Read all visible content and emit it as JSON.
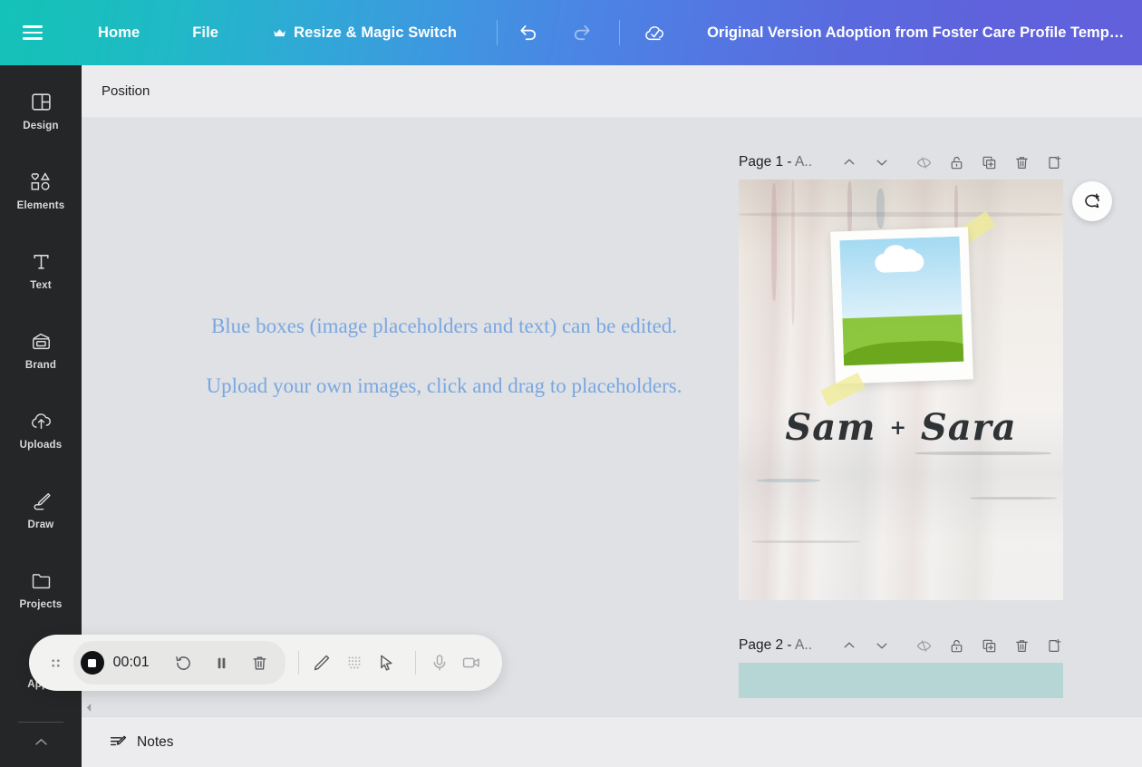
{
  "topbar": {
    "menu_icon": "hamburger-menu-icon",
    "home_label": "Home",
    "file_label": "File",
    "resize_label": "Resize & Magic Switch",
    "resize_badge_icon": "crown-icon",
    "undo_icon": "undo-arrow-icon",
    "redo_icon": "redo-arrow-icon",
    "saved_icon": "cloud-check-icon",
    "design_title": "Original Version Adoption from Foster Care Profile Temp…",
    "gradient_start": "#15c2b8",
    "gradient_end": "#6260db"
  },
  "sidebar": {
    "items": [
      {
        "label": "Design",
        "icon": "layout-design-icon"
      },
      {
        "label": "Elements",
        "icon": "shapes-elements-icon"
      },
      {
        "label": "Text",
        "icon": "text-t-icon"
      },
      {
        "label": "Brand",
        "icon": "brand-kit-icon"
      },
      {
        "label": "Uploads",
        "icon": "cloud-upload-icon"
      },
      {
        "label": "Draw",
        "icon": "pen-draw-icon"
      },
      {
        "label": "Projects",
        "icon": "folder-projects-icon"
      },
      {
        "label": "Apps",
        "icon": "apps-grid-icon"
      }
    ],
    "collapse_icon": "chevron-up-icon"
  },
  "toolbar": {
    "position_label": "Position"
  },
  "canvas": {
    "background_color": "#dfe1e5",
    "hint_line_1": "Blue boxes (image placeholders and text) can be edited.",
    "hint_line_2": "Upload your own images, click and drag to placeholders.",
    "hint_color": "#7aa7e0",
    "comment_button_icon": "add-comment-icon",
    "collapse_tab_icon": "chevron-up-icon",
    "scroll_left_icon": "scroll-left-arrow-icon"
  },
  "pages": [
    {
      "name_visible": "Page 1 - A..",
      "name_prefix": "Page 1 - ",
      "name_suffix": "A..",
      "controls": [
        {
          "icon": "chevron-up-icon",
          "name": "move-page-up"
        },
        {
          "icon": "chevron-down-icon",
          "name": "move-page-down"
        },
        {
          "icon": "eye-hidden-icon",
          "name": "hide-page"
        },
        {
          "icon": "unlock-icon",
          "name": "lock-page"
        },
        {
          "icon": "duplicate-page-icon",
          "name": "duplicate-page"
        },
        {
          "icon": "trash-icon",
          "name": "delete-page"
        },
        {
          "icon": "add-page-icon",
          "name": "add-page"
        }
      ],
      "artwork": {
        "title_text": "Sam + Sara",
        "name_left": "Sam",
        "separator": "+",
        "name_right": "Sara",
        "background": "textured-plaster-wall",
        "photo": "polaroid-landscape-photo",
        "photo_colors": {
          "sky": "#a3daf2",
          "cloud": "#ffffff",
          "hill_back": "#8dc63f",
          "hill_front": "#6ba81e"
        },
        "tape_color": "#f0ec96"
      }
    },
    {
      "name_visible": "Page 2 - A..",
      "name_prefix": "Page 2 - ",
      "name_suffix": "A..",
      "controls": [
        {
          "icon": "chevron-up-icon",
          "name": "move-page-up"
        },
        {
          "icon": "chevron-down-icon",
          "name": "move-page-down"
        },
        {
          "icon": "eye-hidden-icon",
          "name": "hide-page"
        },
        {
          "icon": "unlock-icon",
          "name": "lock-page"
        },
        {
          "icon": "duplicate-page-icon",
          "name": "duplicate-page"
        },
        {
          "icon": "trash-icon",
          "name": "delete-page"
        },
        {
          "icon": "add-page-icon",
          "name": "add-page"
        }
      ],
      "artwork": {
        "background_color": "#b6d5d5"
      }
    }
  ],
  "notes": {
    "label": "Notes",
    "icon": "notes-pencil-icon"
  },
  "recorder": {
    "drag_handle_icon": "drag-dots-icon",
    "stop_icon": "stop-record-icon",
    "elapsed_time": "00:01",
    "restart_icon": "restart-arrow-icon",
    "pause_icon": "pause-icon",
    "delete_icon": "trash-icon",
    "pen_icon": "pencil-icon",
    "effects_icon": "dotted-grid-icon",
    "cursor_icon": "cursor-arrow-icon",
    "mic_icon": "microphone-icon",
    "camera_icon": "video-camera-icon"
  }
}
